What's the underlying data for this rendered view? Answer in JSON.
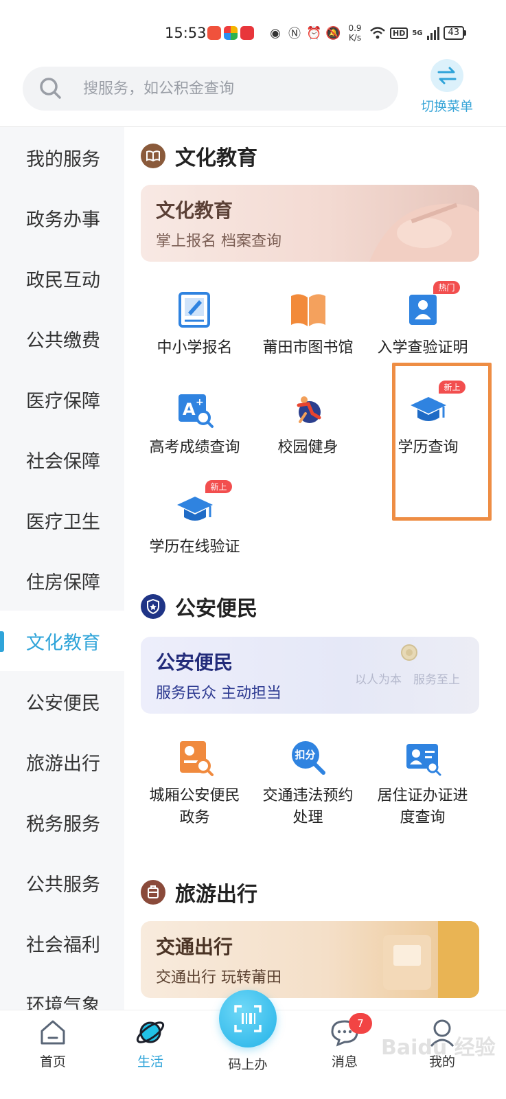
{
  "status_bar": {
    "time": "15:53",
    "net_speed_value": "0.9",
    "net_speed_unit": "K/s",
    "hd": "HD",
    "network_type": "5G",
    "battery": "43",
    "icons": [
      "eye-icon",
      "nfc-icon",
      "alarm-icon",
      "mute-icon",
      "wifi-icon",
      "signal-icon"
    ]
  },
  "search": {
    "placeholder": "搜服务，如公积金查询",
    "value": ""
  },
  "switch_menu": {
    "label": "切换菜单"
  },
  "sidebar": {
    "items": [
      {
        "label": "我的服务"
      },
      {
        "label": "政务办事"
      },
      {
        "label": "政民互动"
      },
      {
        "label": "公共缴费"
      },
      {
        "label": "医疗保障"
      },
      {
        "label": "社会保障"
      },
      {
        "label": "医疗卫生"
      },
      {
        "label": "住房保障"
      },
      {
        "label": "文化教育",
        "active": true
      },
      {
        "label": "公安便民"
      },
      {
        "label": "旅游出行"
      },
      {
        "label": "税务服务"
      },
      {
        "label": "公共服务"
      },
      {
        "label": "社会福利"
      },
      {
        "label": "环境气象"
      }
    ]
  },
  "sections": {
    "culture": {
      "title": "文化教育",
      "banner_title": "文化教育",
      "banner_sub": "掌上报名 档案查询",
      "services": [
        {
          "label": "中小学报名",
          "icon": "form-icon"
        },
        {
          "label": "莆田市图书馆",
          "icon": "book-icon"
        },
        {
          "label": "入学查验证明",
          "icon": "certificate-icon",
          "badge": "热门"
        },
        {
          "label": "高考成绩查询",
          "icon": "score-icon"
        },
        {
          "label": "校园健身",
          "icon": "fitness-icon"
        },
        {
          "label": "学历查询",
          "icon": "graduation-cap-icon",
          "badge": "新上"
        },
        {
          "label": "学历在线验证",
          "icon": "graduation-cap-icon",
          "badge": "新上"
        }
      ]
    },
    "police": {
      "title": "公安便民",
      "banner_title": "公安便民",
      "banner_sub": "服务民众 主动担当",
      "banner_slogan": "以人为本　服务至上",
      "services": [
        {
          "label": "城厢公安便民",
          "label2": "政务",
          "icon": "police-service-icon"
        },
        {
          "label": "交通违法预约",
          "label2": "处理",
          "icon": "deduction-icon",
          "icon_text": "扣分"
        },
        {
          "label": "居住证办证进",
          "label2": "度查询",
          "icon": "residence-card-icon"
        }
      ]
    },
    "travel": {
      "title": "旅游出行",
      "banner_title": "交通出行",
      "banner_sub": "交通出行 玩转莆田"
    }
  },
  "bottom_nav": {
    "items": [
      {
        "label": "首页",
        "icon": "home-icon"
      },
      {
        "label": "生活",
        "icon": "planet-icon",
        "active": true
      },
      {
        "label": "码上办",
        "icon": "scan-code-icon"
      },
      {
        "label": "消息",
        "icon": "message-icon",
        "badge": "7"
      },
      {
        "label": "我的",
        "icon": "profile-icon"
      }
    ]
  },
  "watermark": "Baidu 经验",
  "colors": {
    "accent": "#2fa4d9",
    "highlight_box": "#ee8d44",
    "badge": "#f24e4e"
  }
}
